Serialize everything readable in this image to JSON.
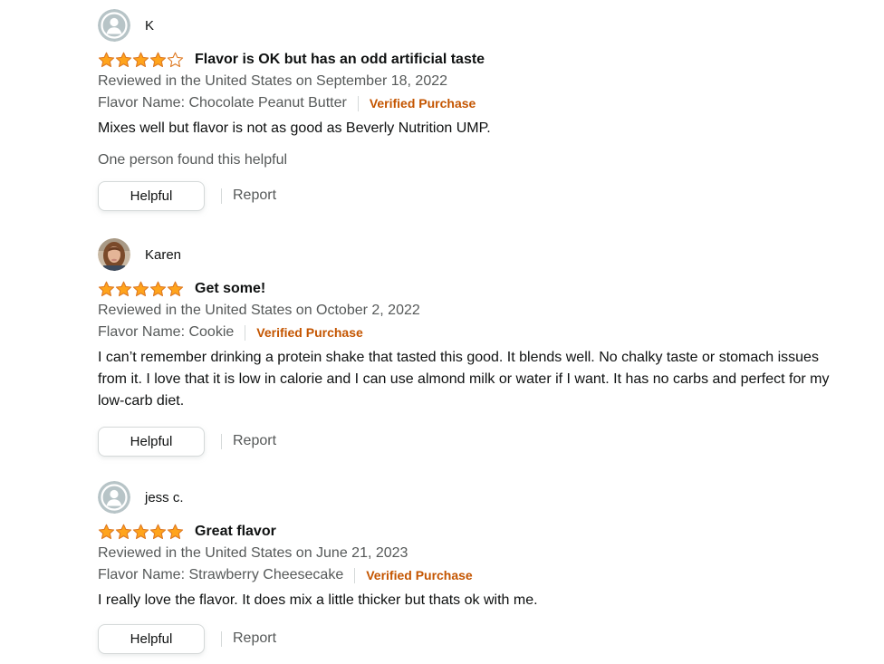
{
  "colors": {
    "star_fill": "#ffa41c",
    "star_outline": "#de7921",
    "verified": "#c45500",
    "meta_text": "#565959",
    "avatar_bg": "#b7c4c7"
  },
  "reviews": [
    {
      "profile_name": "K",
      "avatar": "default-avatar-icon",
      "rating": 4,
      "title": "Flavor is OK but has an odd artificial taste",
      "review_date": "Reviewed in the United States on September 18, 2022",
      "format": "Flavor Name: Chocolate Peanut Butter",
      "verified": "Verified Purchase",
      "body": "Mixes well but flavor is not as good as Beverly Nutrition UMP.",
      "helpful_count": "One person found this helpful",
      "helpful_label": "Helpful",
      "report_label": "Report"
    },
    {
      "profile_name": "Karen",
      "avatar": "user-photo-avatar",
      "rating": 5,
      "title": "Get some!",
      "review_date": "Reviewed in the United States on October 2, 2022",
      "format": "Flavor Name: Cookie",
      "verified": "Verified Purchase",
      "body": "I can’t remember drinking a protein shake that tasted this good. It blends well. No chalky taste or stomach issues from it. I love that it is low in calorie and I can use almond milk or water if I want. It has no carbs and perfect for my low-carb diet.",
      "helpful_label": "Helpful",
      "report_label": "Report"
    },
    {
      "profile_name": "jess c.",
      "avatar": "default-avatar-icon",
      "rating": 5,
      "title": "Great flavor",
      "review_date": "Reviewed in the United States on June 21, 2023",
      "format": "Flavor Name: Strawberry Cheesecake",
      "verified": "Verified Purchase",
      "body": "I really love the flavor. It does mix a little thicker but thats ok with me.",
      "helpful_label": "Helpful",
      "report_label": "Report"
    }
  ]
}
